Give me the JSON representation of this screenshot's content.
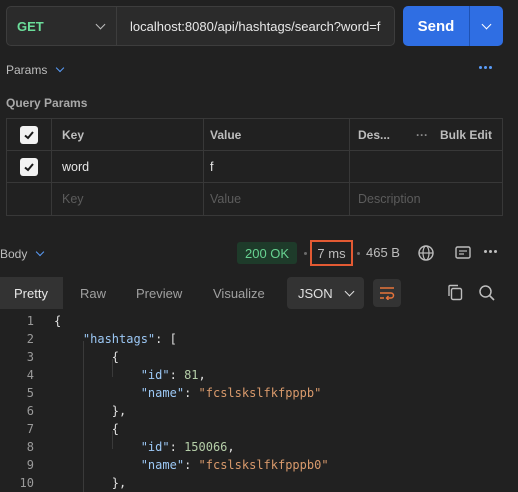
{
  "request": {
    "method": "GET",
    "url": "localhost:8080/api/hashtags/search?word=f",
    "send_label": "Send"
  },
  "params": {
    "tab_label": "Params",
    "section_title": "Query Params",
    "headers": {
      "key": "Key",
      "value": "Value",
      "description": "Des...",
      "bulk_edit": "Bulk Edit"
    },
    "rows": [
      {
        "checked": true,
        "key": "word",
        "value": "f",
        "description": ""
      }
    ],
    "placeholder": {
      "key": "Key",
      "value": "Value",
      "description": "Description"
    }
  },
  "response": {
    "body_label": "Body",
    "status": "200 OK",
    "time": "7 ms",
    "size": "465 B",
    "view_tabs": [
      "Pretty",
      "Raw",
      "Preview",
      "Visualize"
    ],
    "active_view": "Pretty",
    "format": "JSON"
  },
  "code_lines": [
    {
      "n": "1",
      "t": [
        {
          "c": "p",
          "v": "{"
        }
      ]
    },
    {
      "n": "2",
      "t": [
        {
          "c": "p",
          "v": "    "
        },
        {
          "c": "k",
          "v": "\"hashtags\""
        },
        {
          "c": "p",
          "v": ": ["
        }
      ]
    },
    {
      "n": "3",
      "t": [
        {
          "c": "p",
          "v": "        {"
        }
      ]
    },
    {
      "n": "4",
      "t": [
        {
          "c": "p",
          "v": "            "
        },
        {
          "c": "k",
          "v": "\"id\""
        },
        {
          "c": "p",
          "v": ": "
        },
        {
          "c": "n",
          "v": "81"
        },
        {
          "c": "p",
          "v": ","
        }
      ]
    },
    {
      "n": "5",
      "t": [
        {
          "c": "p",
          "v": "            "
        },
        {
          "c": "k",
          "v": "\"name\""
        },
        {
          "c": "p",
          "v": ": "
        },
        {
          "c": "s",
          "v": "\"fcslskslfkfpppb\""
        }
      ]
    },
    {
      "n": "6",
      "t": [
        {
          "c": "p",
          "v": "        },"
        }
      ]
    },
    {
      "n": "7",
      "t": [
        {
          "c": "p",
          "v": "        {"
        }
      ]
    },
    {
      "n": "8",
      "t": [
        {
          "c": "p",
          "v": "            "
        },
        {
          "c": "k",
          "v": "\"id\""
        },
        {
          "c": "p",
          "v": ": "
        },
        {
          "c": "n",
          "v": "150066"
        },
        {
          "c": "p",
          "v": ","
        }
      ]
    },
    {
      "n": "9",
      "t": [
        {
          "c": "p",
          "v": "            "
        },
        {
          "c": "k",
          "v": "\"name\""
        },
        {
          "c": "p",
          "v": ": "
        },
        {
          "c": "s",
          "v": "\"fcslskslfkfpppb0\""
        }
      ]
    },
    {
      "n": "10",
      "t": [
        {
          "c": "p",
          "v": "        },"
        }
      ]
    }
  ],
  "colors": {
    "accent": "#2f6ee3",
    "method_get": "#6bdd9a",
    "status_ok": "#67d291",
    "highlight_box": "#e35a33"
  }
}
